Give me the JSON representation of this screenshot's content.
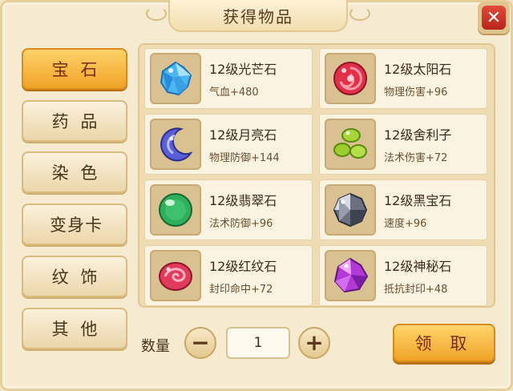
{
  "title": "获得物品",
  "close_label": "✕",
  "tabs": [
    {
      "label": "宝 石",
      "active": true
    },
    {
      "label": "药 品",
      "active": false
    },
    {
      "label": "染 色",
      "active": false
    },
    {
      "label": "变身卡",
      "active": false
    },
    {
      "label": "纹 饰",
      "active": false
    },
    {
      "label": "其 他",
      "active": false
    }
  ],
  "items": [
    {
      "name": "12级光芒石",
      "stat": "气血+480",
      "icon": "blue-crystal-icon",
      "color": "#3aa6e8"
    },
    {
      "name": "12级太阳石",
      "stat": "物理伤害+96",
      "icon": "red-sun-stone-icon",
      "color": "#e2304a"
    },
    {
      "name": "12级月亮石",
      "stat": "物理防御+144",
      "icon": "crescent-moon-stone-icon",
      "color": "#5a5fd8"
    },
    {
      "name": "12级舍利子",
      "stat": "法术伤害+72",
      "icon": "green-relic-beads-icon",
      "color": "#9ccc2e"
    },
    {
      "name": "12级翡翠石",
      "stat": "法术防御+96",
      "icon": "jade-orb-icon",
      "color": "#2fae5c"
    },
    {
      "name": "12级黑宝石",
      "stat": "速度+96",
      "icon": "black-diamond-icon",
      "color": "#6d7080"
    },
    {
      "name": "12级红纹石",
      "stat": "封印命中+72",
      "icon": "red-swirl-stone-icon",
      "color": "#e23a5a"
    },
    {
      "name": "12级神秘石",
      "stat": "抵抗封印+48",
      "icon": "purple-mystic-crystal-icon",
      "color": "#b23ad6"
    }
  ],
  "quantity": {
    "label": "数量",
    "value": "1",
    "minus_label": "−",
    "plus_label": "+"
  },
  "claim_label": "领 取"
}
